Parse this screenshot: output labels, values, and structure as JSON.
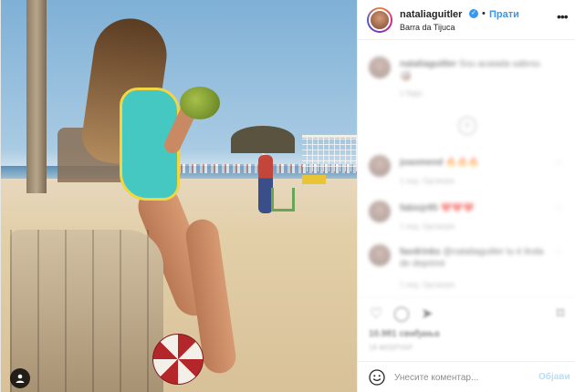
{
  "post": {
    "username": "nataliaguitler",
    "follow_label": "Прати",
    "location": "Barra da Tijuca",
    "separator": "•"
  },
  "comments": [
    {
      "user": "nataliaguitler",
      "text": "Sou acaiada sabrou 🥥",
      "meta": "1 Ngiju"
    },
    {
      "user": "joaomend",
      "text": "🔥🔥🔥",
      "meta": "1 нед.   Одговори"
    },
    {
      "user": "fabiojr85",
      "text": "❤️❤️❤️",
      "meta": "1 нед.   Одговори"
    },
    {
      "user": "favdrinks",
      "text": "@nataliaguitler tu é linda de deprimir",
      "meta": "1 нед.   Одговори"
    }
  ],
  "actions": {
    "likes": "10.981 свиђања",
    "date": "18 ФЕБРУАР"
  },
  "comment_bar": {
    "placeholder": "Унесите коментар...",
    "post_label": "Објави"
  },
  "icons": {
    "verified": "verified-badge-icon",
    "more": "more-options-icon",
    "heart": "heart-icon",
    "comment": "comment-icon",
    "share": "share-icon",
    "save": "bookmark-icon",
    "emoji": "emoji-icon",
    "user_tag": "user-tag-icon"
  },
  "colors": {
    "accent": "#3897f0",
    "post_disabled": "#b2dffc",
    "text": "#262626",
    "muted": "#8e8e8e"
  }
}
